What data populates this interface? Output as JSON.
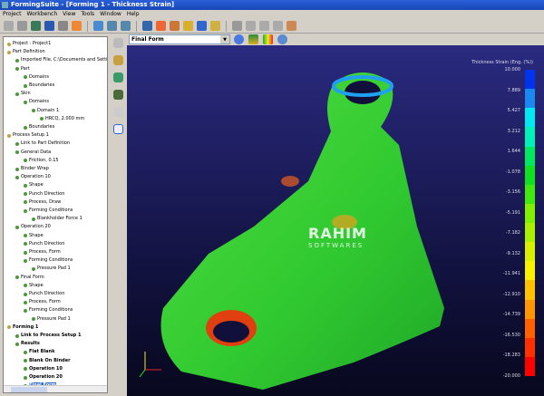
{
  "window": {
    "title": "FormingSuite - [Forming 1 - Thickness Strain]"
  },
  "menu": [
    "Project",
    "Workbench",
    "View",
    "Tools",
    "Window",
    "Help"
  ],
  "view_selector": {
    "value": "Final Form"
  },
  "tree": [
    {
      "label": "Project : Project1",
      "lvl": 0,
      "bold": false
    },
    {
      "label": "Part Definition",
      "lvl": 0
    },
    {
      "label": "Imported File, C:\\Documents and Settin",
      "lvl": 1
    },
    {
      "label": "Part",
      "lvl": 1
    },
    {
      "label": "Domains",
      "lvl": 2
    },
    {
      "label": "Boundaries",
      "lvl": 2
    },
    {
      "label": "Skin",
      "lvl": 1
    },
    {
      "label": "Domains",
      "lvl": 2
    },
    {
      "label": "Domain 1",
      "lvl": 3
    },
    {
      "label": "HRCQ, 2.000 mm",
      "lvl": 4
    },
    {
      "label": "Boundaries",
      "lvl": 2
    },
    {
      "label": "Process Setup 1",
      "lvl": 0
    },
    {
      "label": "Link to Part Definition",
      "lvl": 1
    },
    {
      "label": "General Data",
      "lvl": 1
    },
    {
      "label": "Friction, 0.15",
      "lvl": 2
    },
    {
      "label": "Binder Wrap",
      "lvl": 1
    },
    {
      "label": "Operation 10",
      "lvl": 1
    },
    {
      "label": "Shape",
      "lvl": 2
    },
    {
      "label": "Punch Direction",
      "lvl": 2
    },
    {
      "label": "Process, Draw",
      "lvl": 2
    },
    {
      "label": "Forming Conditions",
      "lvl": 2
    },
    {
      "label": "Blankholder Force 1",
      "lvl": 3
    },
    {
      "label": "Operation 20",
      "lvl": 1
    },
    {
      "label": "Shape",
      "lvl": 2
    },
    {
      "label": "Punch Direction",
      "lvl": 2
    },
    {
      "label": "Process, Form",
      "lvl": 2
    },
    {
      "label": "Forming Conditions",
      "lvl": 2
    },
    {
      "label": "Pressure Pad 1",
      "lvl": 3
    },
    {
      "label": "Final Form",
      "lvl": 1
    },
    {
      "label": "Shape",
      "lvl": 2
    },
    {
      "label": "Punch Direction",
      "lvl": 2
    },
    {
      "label": "Process, Form",
      "lvl": 2
    },
    {
      "label": "Forming Conditions",
      "lvl": 2
    },
    {
      "label": "Pressure Pad 1",
      "lvl": 3
    },
    {
      "label": "Forming 1",
      "lvl": 0,
      "bold": true
    },
    {
      "label": "Link to Process Setup 1",
      "lvl": 1,
      "bold": true
    },
    {
      "label": "Results",
      "lvl": 1,
      "bold": true
    },
    {
      "label": "Flat Blank",
      "lvl": 2,
      "bold": true
    },
    {
      "label": "Blank On Binder",
      "lvl": 2,
      "bold": true
    },
    {
      "label": "Operation 10",
      "lvl": 2,
      "bold": true
    },
    {
      "label": "Operation 20",
      "lvl": 2,
      "bold": true
    },
    {
      "label": "Final Form",
      "lvl": 2,
      "bold": true,
      "selected": true
    }
  ],
  "legend": {
    "title": "Thickness Strain (Eng. (%))",
    "labels": [
      "10.000",
      "7.889",
      "5.427",
      "3.212",
      "1.644",
      "-1.078",
      "-3.156",
      "-5.191",
      "-7.182",
      "-9.132",
      "-11.941",
      "-12.910",
      "-14.739",
      "-16.530",
      "-18.283",
      "-20.000"
    ],
    "colors": [
      "#0033ee",
      "#1a88f0",
      "#00e8f0",
      "#00f0b8",
      "#00e860",
      "#10e020",
      "#40e810",
      "#80f000",
      "#a8f000",
      "#d8f000",
      "#f8f000",
      "#ffc000",
      "#ff9800",
      "#ff6000",
      "#ff3000",
      "#ff0000"
    ]
  },
  "watermark": {
    "line1": "RAHIM",
    "line2": "SOFTWARES"
  }
}
